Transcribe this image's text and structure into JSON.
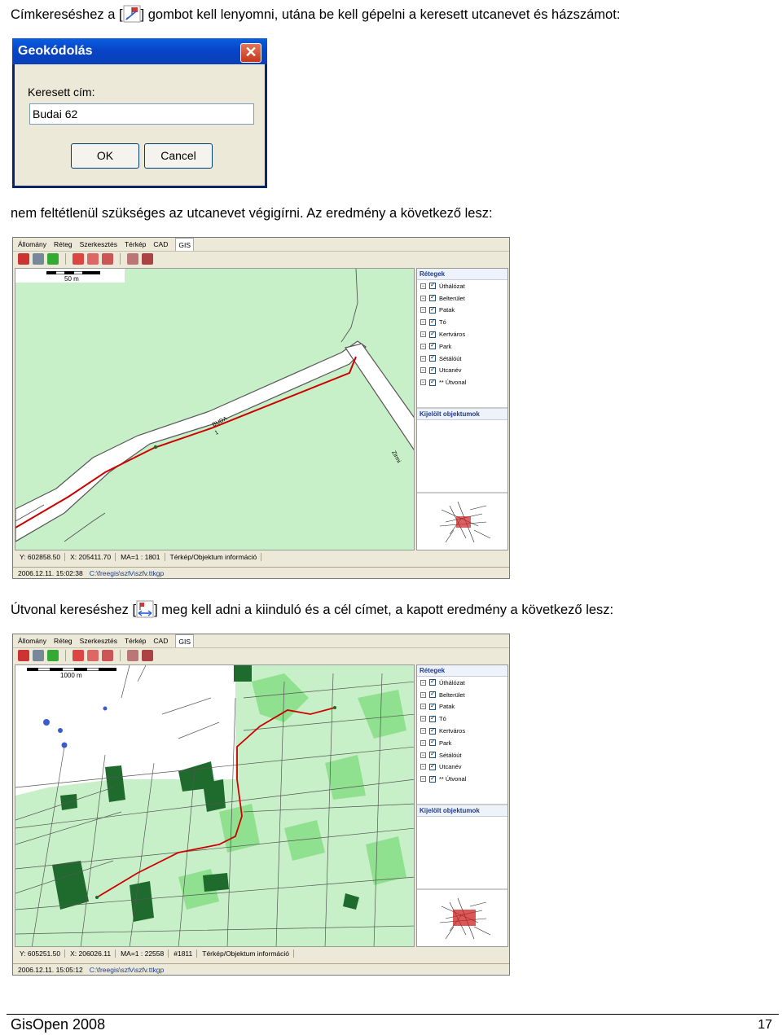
{
  "intro": {
    "before_icon": "Címkereséshez a [",
    "after_icon": "] gombot kell lenyomni, utána be kell gépelni a keresett utcanevet és házszámot:",
    "icon": "geocode-tool-icon"
  },
  "dialog": {
    "title": "Geokódolás",
    "label": "Keresett cím:",
    "input_value": "Budai 62",
    "ok_label": "OK",
    "cancel_label": "Cancel"
  },
  "para2": "nem feltétlenül szükséges az utcanevet végigírni. Az eredmény a következő lesz:",
  "app": {
    "menu": [
      "Állomány",
      "Réteg",
      "Szerkesztés",
      "Térkép",
      "CAD",
      "GIS"
    ],
    "layers_title": "Rétegek",
    "layers": [
      "Úthálózat",
      "Belterület",
      "Patak",
      "Tó",
      "Kertváros",
      "Park",
      "Sétálóút",
      "Utcanév",
      "** Útvonal"
    ],
    "selected_title": "Kijelölt objektumok",
    "status_tab": "Térkép/Objektum információ",
    "project_path": "C:\\freegis\\szfv\\szfv.ttkgp"
  },
  "fig1": {
    "scale_label": "50 m",
    "street_label": "BUDA",
    "street_number": "1",
    "side_street": "Zirmi",
    "y": "Y: 602858.50",
    "x": "X: 205411.70",
    "ma": "MA=1 : 1801",
    "datetime": "2006.12.11. 15:02:38"
  },
  "para3": {
    "before_icon": "Útvonal kereséshez [",
    "after_icon": "] meg kell adni a kiinduló és a cél címet, a kapott eredmény a következő lesz:",
    "icon": "route-tool-icon"
  },
  "fig2": {
    "scale_label": "1000 m",
    "y": "Y: 605251.50",
    "x": "X: 206026.11",
    "ma": "MA=1 : 22558",
    "object_id": "#1811",
    "datetime": "2006.12.11. 15:05:12"
  },
  "footer": {
    "left": "GisOpen 2008",
    "right": "17"
  },
  "colors": {
    "map_bg": "#c8f0c8",
    "map_park": "#8fe08f",
    "map_forest": "#1f6b2e",
    "route": "#cc0000",
    "road_fill": "#ffffff",
    "road_edge": "#555555"
  }
}
